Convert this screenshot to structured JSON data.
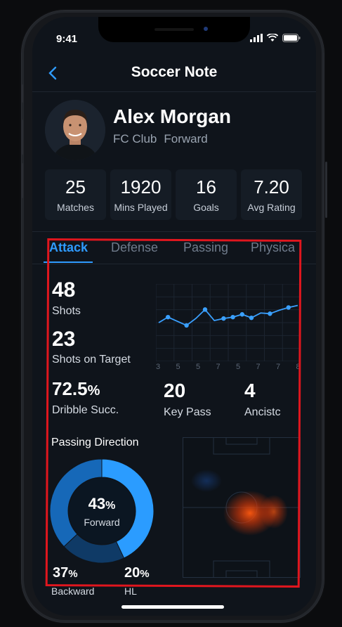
{
  "status": {
    "time": "9:41"
  },
  "nav": {
    "title": "Soccer Note"
  },
  "player": {
    "name": "Alex Morgan",
    "club": "FC Club",
    "position": "Forward"
  },
  "stats": [
    {
      "value": "25",
      "label": "Matches"
    },
    {
      "value": "1920",
      "label": "Mins Played"
    },
    {
      "value": "16",
      "label": "Goals"
    },
    {
      "value": "7.20",
      "label": "Avg Rating"
    }
  ],
  "tabs": [
    "Attack",
    "Defense",
    "Passing",
    "Physica"
  ],
  "attack": {
    "shots": {
      "value": "48",
      "label": "Shots"
    },
    "on_target": {
      "value": "23",
      "label": "Shots on Target"
    },
    "dribble": {
      "value": "72.5",
      "unit": "%",
      "label": "Dribble Succ."
    },
    "key_pass": {
      "value": "20",
      "label": "Key Pass"
    },
    "assist": {
      "value": "4",
      "label": "Ancistc"
    }
  },
  "chart_data": {
    "type": "line",
    "x_tick_labels": [
      "3",
      "5",
      "5",
      "7",
      "5",
      "7",
      "7",
      "8"
    ],
    "values": [
      5.0,
      5.8,
      5.2,
      4.6,
      5.6,
      6.9,
      5.3,
      5.6,
      5.8,
      6.2,
      5.7,
      6.4,
      6.3,
      6.8,
      7.2,
      7.5
    ],
    "color": "#3aa0ff",
    "grid": true,
    "ylim": [
      0,
      10
    ]
  },
  "passing": {
    "title": "Passing Direction",
    "center_value": "43",
    "center_unit": "%",
    "center_label": "Forward",
    "segments": [
      {
        "name": "Forward",
        "value": 43,
        "color": "#2b9cff"
      },
      {
        "name": "HL",
        "value": 20,
        "color": "#0f3a66"
      },
      {
        "name": "Backward",
        "value": 37,
        "color": "#1668b8"
      }
    ],
    "backward": {
      "value": "37",
      "unit": "%",
      "label": "Backward"
    },
    "hl": {
      "value": "20",
      "unit": "%",
      "label": "HL"
    }
  },
  "colors": {
    "accent": "#2f9bff",
    "annotation": "#e0161e",
    "heat": "#ff5a10"
  }
}
